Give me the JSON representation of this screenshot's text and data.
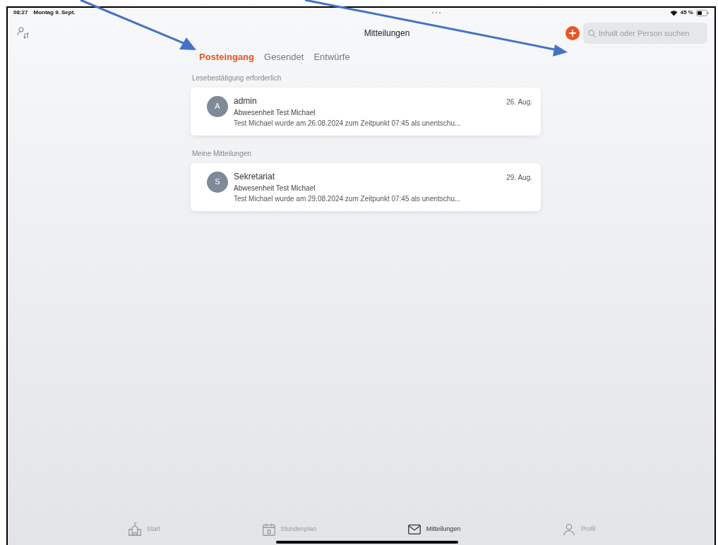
{
  "status_bar": {
    "time": "08:27",
    "date": "Montag 9. Sept.",
    "battery": "45 %"
  },
  "header": {
    "title": "Mitteilungen",
    "search": {
      "placeholder": "Inhalt oder Person suchen"
    }
  },
  "tabs": [
    {
      "label": "Posteingang",
      "selected": true
    },
    {
      "label": "Gesendet",
      "selected": false
    },
    {
      "label": "Entwürfe",
      "selected": false
    }
  ],
  "sections": [
    {
      "title": "Lesebestätigung erforderlich",
      "messages": [
        {
          "initial": "A",
          "sender": "admin",
          "date": "26. Aug.",
          "subject": "Abwesenheit Test Michael",
          "preview": "Test Michael wurde am 26.08.2024 zum Zeitpunkt 07:45 als unentschu..."
        }
      ]
    },
    {
      "title": "Meine Mitteilungen",
      "messages": [
        {
          "initial": "S",
          "sender": "Sekretariat",
          "date": "29. Aug.",
          "subject": "Abwesenheit Test Michael",
          "preview": "Test Michael wurde am 29.08.2024 zum Zeitpunkt 07:45 als unentschu..."
        }
      ]
    }
  ],
  "bottom_tabs": [
    {
      "kind": "start",
      "label": "Start",
      "selected": false
    },
    {
      "kind": "calendar",
      "label": "Stundenplan",
      "selected": false
    },
    {
      "kind": "mail",
      "label": "Mitteilungen",
      "selected": true
    },
    {
      "kind": "person",
      "label": "Profil",
      "selected": false
    }
  ]
}
